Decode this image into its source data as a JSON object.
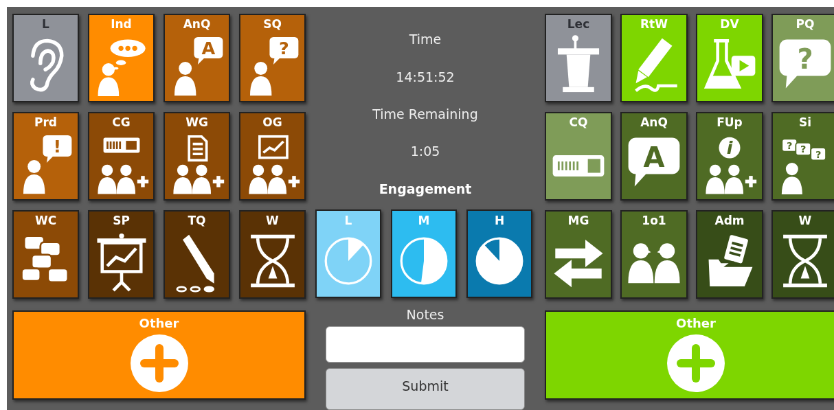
{
  "left_tiles": [
    {
      "label": "L",
      "color": "#8f9299",
      "kind": "ear"
    },
    {
      "label": "Ind",
      "color": "#ff8c00",
      "kind": "thought"
    },
    {
      "label": "AnQ",
      "color": "#b5610a",
      "kind": "bubble-person",
      "glyphs": [
        "A"
      ]
    },
    {
      "label": "SQ",
      "color": "#b5610a",
      "kind": "bubble-person",
      "glyphs": [
        "?"
      ]
    },
    {
      "label": "Prd",
      "color": "#b5610a",
      "kind": "bubble-person",
      "glyphs": [
        "!"
      ]
    },
    {
      "label": "CG",
      "color": "#8c4a06",
      "kind": "clicker-group"
    },
    {
      "label": "WG",
      "color": "#8c4a06",
      "kind": "document-group"
    },
    {
      "label": "OG",
      "color": "#8c4a06",
      "kind": "chart-group"
    },
    {
      "label": "WC",
      "color": "#8c4a06",
      "kind": "chat"
    },
    {
      "label": "SP",
      "color": "#5a3205",
      "kind": "presentation"
    },
    {
      "label": "TQ",
      "color": "#5a3205",
      "kind": "pencil"
    },
    {
      "label": "W",
      "color": "#5a3205",
      "kind": "hourglass"
    }
  ],
  "left_other": {
    "label": "Other",
    "color": "#ff8c00"
  },
  "center": {
    "time_label": "Time",
    "time": "14:51:52",
    "remaining_label": "Time Remaining",
    "remaining": "1:05",
    "engagement_label": "Engagement",
    "engagement": [
      {
        "label": "L",
        "color": "#7fd3f7",
        "kind": "low"
      },
      {
        "label": "M",
        "color": "#2dbcf0",
        "kind": "medium"
      },
      {
        "label": "H",
        "color": "#0a7aae",
        "kind": "high"
      }
    ],
    "notes_label": "Notes",
    "submit": "Submit"
  },
  "right_tiles": [
    {
      "label": "Lec",
      "color": "#8f9299",
      "kind": "podium"
    },
    {
      "label": "RtW",
      "color": "#7ed600",
      "kind": "marker"
    },
    {
      "label": "DV",
      "color": "#7ed600",
      "kind": "flask-video"
    },
    {
      "label": "PQ",
      "color": "#7f9c58",
      "kind": "big-bubble",
      "glyphs": [
        "?"
      ]
    },
    {
      "label": "CQ",
      "color": "#7f9c58",
      "kind": "clicker"
    },
    {
      "label": "AnQ",
      "color": "#4f6b24",
      "kind": "big-bubble",
      "glyphs": [
        "A"
      ]
    },
    {
      "label": "FUp",
      "color": "#4f6b24",
      "kind": "info-group",
      "glyphs": [
        "i"
      ]
    },
    {
      "label": "Si",
      "color": "#4f6b24",
      "kind": "questions-person",
      "glyphs": [
        "?",
        "?",
        "?"
      ]
    },
    {
      "label": "MG",
      "color": "#4f6b24",
      "kind": "arrows"
    },
    {
      "label": "1o1",
      "color": "#4f6b24",
      "kind": "pair"
    },
    {
      "label": "Adm",
      "color": "#374d18",
      "kind": "folder"
    },
    {
      "label": "W",
      "color": "#374d18",
      "kind": "hourglass"
    }
  ],
  "right_other": {
    "label": "Other",
    "color": "#7ed600"
  }
}
